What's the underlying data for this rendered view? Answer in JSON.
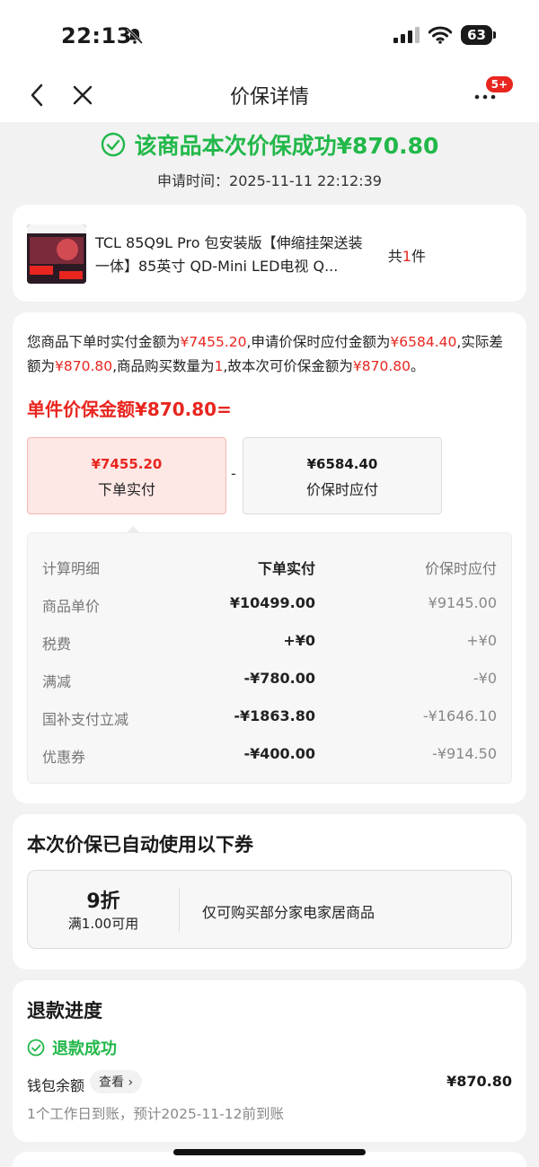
{
  "status_bar": {
    "time": "22:13",
    "battery": "63"
  },
  "nav": {
    "title": "价保详情",
    "badge": "5+"
  },
  "banner": {
    "success_text": "该商品本次价保成功¥870.80",
    "apply_time": "申请时间：2025-11-11 22:12:39"
  },
  "product": {
    "title": "TCL 85Q9L Pro 包安装版【伸缩挂架送装一体】85英寸 QD-Mini LED电视 Q...",
    "count_prefix": "共",
    "count": "1",
    "count_suffix": "件"
  },
  "detail": {
    "desc": [
      {
        "t": "您商品下单时实付金额为",
        "red": false
      },
      {
        "t": "¥7455.20",
        "red": true
      },
      {
        "t": ",申请价保时应付金额为",
        "red": false
      },
      {
        "t": "¥6584.40",
        "red": true
      },
      {
        "t": ",实际差额为",
        "red": false
      },
      {
        "t": "¥870.80",
        "red": true
      },
      {
        "t": ",商品购买数量为",
        "red": false
      },
      {
        "t": "1",
        "red": true
      },
      {
        "t": ",故本次可价保金额为",
        "red": false
      },
      {
        "t": "¥870.80",
        "red": true
      },
      {
        "t": "。",
        "red": false
      }
    ],
    "unit_title": "单件价保金额¥870.80=",
    "paid_box": {
      "amount": "¥7455.20",
      "label": "下单实付"
    },
    "minus": "-",
    "price_box": {
      "amount": "¥6584.40",
      "label": "价保时应付"
    },
    "table": {
      "headers": [
        "计算明细",
        "下单实付",
        "价保时应付"
      ],
      "rows": [
        [
          "商品单价",
          "¥10499.00",
          "¥9145.00"
        ],
        [
          "税费",
          "+¥0",
          "+¥0"
        ],
        [
          "满减",
          "-¥780.00",
          "-¥0"
        ],
        [
          "国补支付立减",
          "-¥1863.80",
          "-¥1646.10"
        ],
        [
          "优惠券",
          "-¥400.00",
          "-¥914.50"
        ]
      ]
    }
  },
  "coupon_section": {
    "title": "本次价保已自动使用以下券",
    "coupon": {
      "discount": "9折",
      "condition": "满1.00可用",
      "desc": "仅可购买部分家电家居商品"
    }
  },
  "refund": {
    "title": "退款进度",
    "status": "退款成功",
    "wallet_label": "钱包余额",
    "view_label": "查看 ›",
    "amount": "¥870.80",
    "arrival": "1个工作日到账，预计2025-11-12前到账"
  },
  "colors": {
    "accent_red": "#e8261f",
    "success_green": "#22b84a"
  }
}
